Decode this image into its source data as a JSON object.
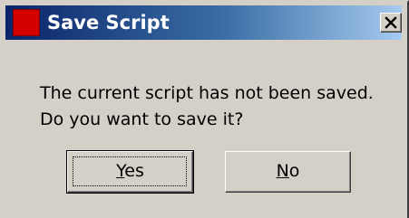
{
  "window": {
    "title": "Save Script",
    "app_icon": "red-crescent-moon-icon",
    "close_icon": "close-icon",
    "titlebar_colors": [
      "#0a246a",
      "#a6caf0"
    ]
  },
  "message": {
    "line1": "The current script has not been saved.",
    "line2": "Do you want to save it?"
  },
  "buttons": {
    "yes": {
      "mnemonic": "Y",
      "rest": "es"
    },
    "no": {
      "mnemonic": "N",
      "rest": "o"
    }
  }
}
